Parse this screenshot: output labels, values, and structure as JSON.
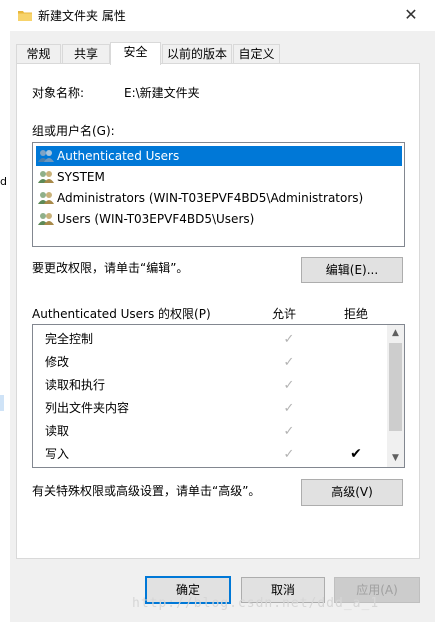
{
  "window": {
    "title": "新建文件夹 属性",
    "close_label": "✕"
  },
  "left_strip": {
    "char": "d"
  },
  "tabs": [
    {
      "label": "常规",
      "active": false
    },
    {
      "label": "共享",
      "active": false
    },
    {
      "label": "安全",
      "active": true
    },
    {
      "label": "以前的版本",
      "active": false
    },
    {
      "label": "自定义",
      "active": false
    }
  ],
  "security": {
    "object_label": "对象名称:",
    "object_value": "E:\\新建文件夹",
    "groups_label": "组或用户名(G):",
    "users": [
      {
        "name": "Authenticated Users",
        "selected": true
      },
      {
        "name": "SYSTEM",
        "selected": false
      },
      {
        "name": "Administrators (WIN-T03EPVF4BD5\\Administrators)",
        "selected": false
      },
      {
        "name": "Users (WIN-T03EPVF4BD5\\Users)",
        "selected": false
      }
    ],
    "edit_hint": "要更改权限，请单击“编辑”。",
    "edit_button": "编辑(E)...",
    "perm_title": "Authenticated Users 的权限(P)",
    "allow_header": "允许",
    "deny_header": "拒绝",
    "permissions": [
      {
        "name": "完全控制",
        "allow": "✓",
        "deny": ""
      },
      {
        "name": "修改",
        "allow": "✓",
        "deny": ""
      },
      {
        "name": "读取和执行",
        "allow": "✓",
        "deny": ""
      },
      {
        "name": "列出文件夹内容",
        "allow": "✓",
        "deny": ""
      },
      {
        "name": "读取",
        "allow": "✓",
        "deny": ""
      },
      {
        "name": "写入",
        "allow": "✓",
        "deny": "✔"
      }
    ],
    "advanced_hint": "有关特殊权限或高级设置，请单击“高级”。",
    "advanced_button": "高级(V)"
  },
  "footer": {
    "ok": "确定",
    "cancel": "取消",
    "apply": "应用(A)"
  },
  "watermark": "http://blog.csdn.net/ddd_a_1",
  "colors": {
    "selection": "#0078d7",
    "focus_border": "#0078d7"
  }
}
